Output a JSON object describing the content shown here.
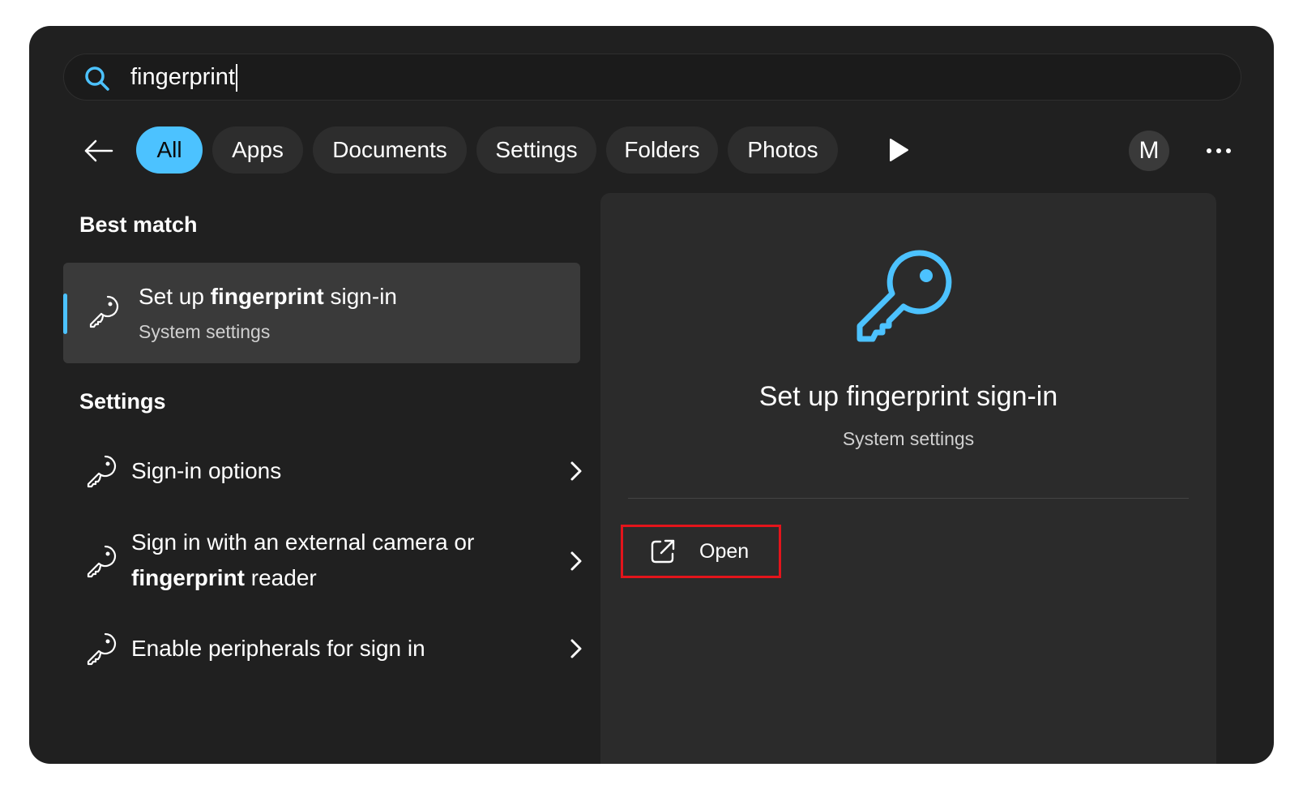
{
  "search": {
    "query": "fingerprint"
  },
  "tabs": [
    {
      "label": "All",
      "active": true
    },
    {
      "label": "Apps"
    },
    {
      "label": "Documents"
    },
    {
      "label": "Settings"
    },
    {
      "label": "Folders"
    },
    {
      "label": "Photos"
    }
  ],
  "account": {
    "initial": "M"
  },
  "best_match": {
    "heading": "Best match",
    "title_pre": "Set up ",
    "title_bold": "fingerprint",
    "title_post": " sign-in",
    "subtitle": "System settings"
  },
  "settings_section": {
    "heading": "Settings",
    "items": [
      {
        "text": "Sign-in options"
      },
      {
        "line1": "Sign in with an external camera or",
        "line2_bold": "fingerprint",
        "line2_rest": " reader"
      },
      {
        "text": "Enable peripherals for sign in"
      }
    ]
  },
  "preview": {
    "title": "Set up fingerprint sign-in",
    "subtitle": "System settings",
    "action_label": "Open"
  },
  "colors": {
    "accent": "#4cc2ff",
    "highlight_box": "#e3141b",
    "window_bg": "#202020"
  },
  "icons": [
    "search-icon",
    "back-arrow-icon",
    "play-icon",
    "more-icon",
    "key-icon",
    "chevron-right-icon",
    "open-external-icon"
  ]
}
